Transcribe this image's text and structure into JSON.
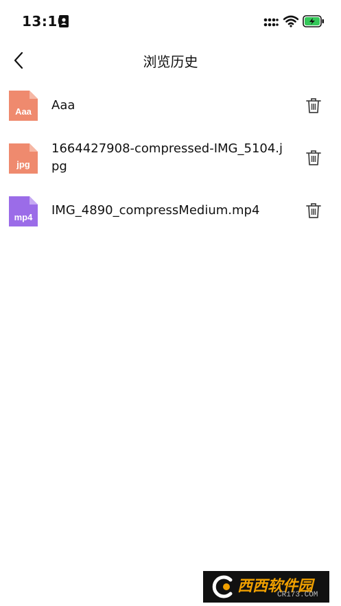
{
  "status_bar": {
    "time": "13:10",
    "icons": [
      "id-badge-icon",
      "signal-icon",
      "wifi-icon",
      "battery-charging-icon"
    ]
  },
  "nav": {
    "back_icon": "chevron-left-icon",
    "title": "浏览历史"
  },
  "files": [
    {
      "name": "Aaa",
      "ext": "Aaa",
      "icon_color": "#ef8a6e"
    },
    {
      "name": "1664427908-compressed-IMG_5104.jpg",
      "ext": "jpg",
      "icon_color": "#ef8a6e"
    },
    {
      "name": "IMG_4890_compressMedium.mp4",
      "ext": "mp4",
      "icon_color": "#9b6ce8"
    }
  ],
  "delete_icon": "trash-icon",
  "watermark": {
    "title": "西西软件园",
    "subtitle": "CR173.COM"
  },
  "colors": {
    "background": "#ffffff",
    "battery_green": "#34c759",
    "doc_icon": "#ef8a6e",
    "video_icon": "#9b6ce8"
  }
}
